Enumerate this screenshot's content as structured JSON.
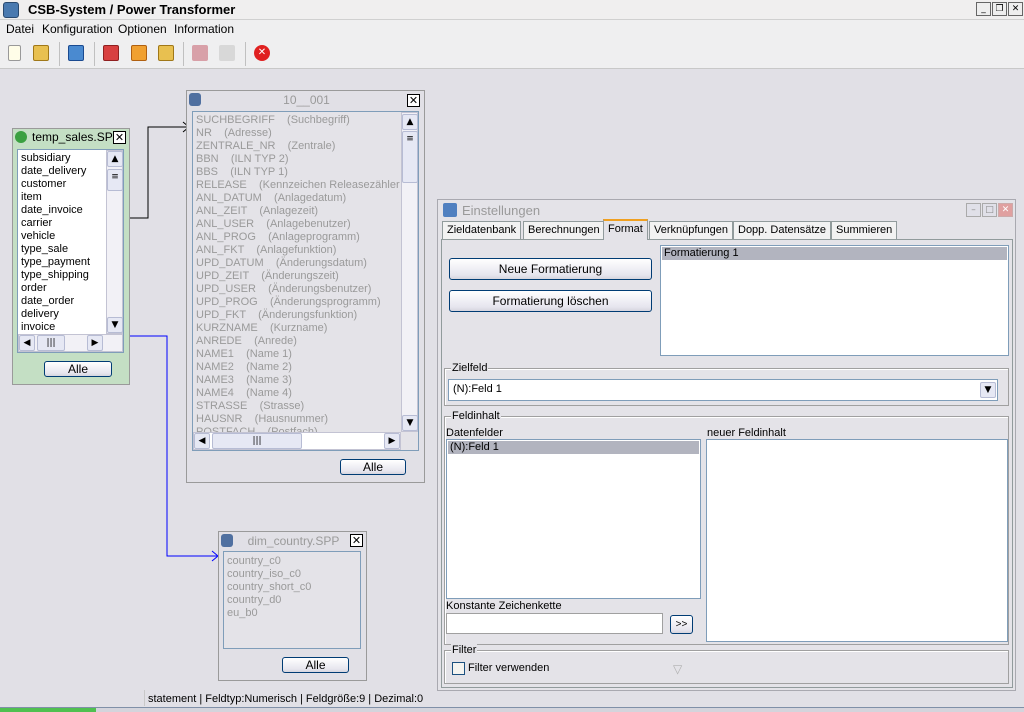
{
  "app": {
    "title": "CSB-System / Power Transformer"
  },
  "menu": [
    "Datei",
    "Konfiguration",
    "Optionen",
    "Information"
  ],
  "toolbar": {
    "icons": [
      "new-file-icon",
      "open-folder-icon",
      "save-icon",
      "open-red-icon",
      "save-orange-icon",
      "open-yellow-icon",
      "tools-icon",
      "print-icon",
      "close-red-icon"
    ]
  },
  "temp_sales": {
    "title": "temp_sales.SPP",
    "items": [
      "subsidiary",
      "date_delivery",
      "customer",
      "item",
      "date_invoice",
      "carrier",
      "vehicle",
      "type_sale",
      "type_payment",
      "type_shipping",
      "order",
      "date_order",
      "delivery",
      "invoice"
    ],
    "all_label": "Alle"
  },
  "table_10_001": {
    "title": "10__001",
    "items": [
      "SUCHBEGRIFF    (Suchbegriff)",
      "NR    (Adresse)",
      "ZENTRALE_NR    (Zentrale)",
      "BBN    (ILN TYP 2)",
      "BBS    (ILN TYP 1)",
      "RELEASE    (Kennzeichen Releasezähler S",
      "ANL_DATUM    (Anlagedatum)",
      "ANL_ZEIT    (Anlagezeit)",
      "ANL_USER    (Anlagebenutzer)",
      "ANL_PROG    (Anlageprogramm)",
      "ANL_FKT    (Anlagefunktion)",
      "UPD_DATUM    (Änderungsdatum)",
      "UPD_ZEIT    (Änderungszeit)",
      "UPD_USER    (Änderungsbenutzer)",
      "UPD_PROG    (Änderungsprogramm)",
      "UPD_FKT    (Änderungsfunktion)",
      "KURZNAME    (Kurzname)",
      "ANREDE    (Anrede)",
      "NAME1    (Name 1)",
      "NAME2    (Name 2)",
      "NAME3    (Name 3)",
      "NAME4    (Name 4)",
      "STRASSE    (Strasse)",
      "HAUSNR    (Hausnummer)",
      "POSTFACH    (Postfach)"
    ],
    "all_label": "Alle"
  },
  "dim_country": {
    "title": "dim_country.SPP",
    "items": [
      "country_c0",
      "country_iso_c0",
      "country_short_c0",
      "country_d0",
      "eu_b0"
    ],
    "all_label": "Alle"
  },
  "settings": {
    "title": "Einstellungen",
    "tabs": [
      "Zieldatenbank",
      "Berechnungen",
      "Format",
      "Verknüpfungen",
      "Dopp. Datensätze",
      "Summieren"
    ],
    "active_tab": "Format",
    "new_format_label": "Neue Formatierung",
    "delete_format_label": "Formatierung löschen",
    "formats": [
      "Formatierung 1"
    ],
    "zielfeld_label": "Zielfeld",
    "zielfeld_value": "(N):Feld 1",
    "feldinhalt_label": "Feldinhalt",
    "datenfelder_label": "Datenfelder",
    "datenfelder": [
      "(N):Feld 1"
    ],
    "neuer_feldinhalt_label": "neuer Feldinhalt",
    "konstante_label": "Konstante Zeichenkette",
    "konstante_value": "",
    "add_label": ">>",
    "filter_group_label": "Filter",
    "filter_checkbox_label": "Filter verwenden",
    "filter_checked": false
  },
  "status": {
    "text": "statement | Feldtyp:Numerisch | Feldgröße:9 | Dezimal:0"
  },
  "colors": {
    "link_active": "#0000ff",
    "panel_green": "#c4dfc4",
    "selection": "#b2b4bf",
    "tab_accent": "#f0a020"
  }
}
